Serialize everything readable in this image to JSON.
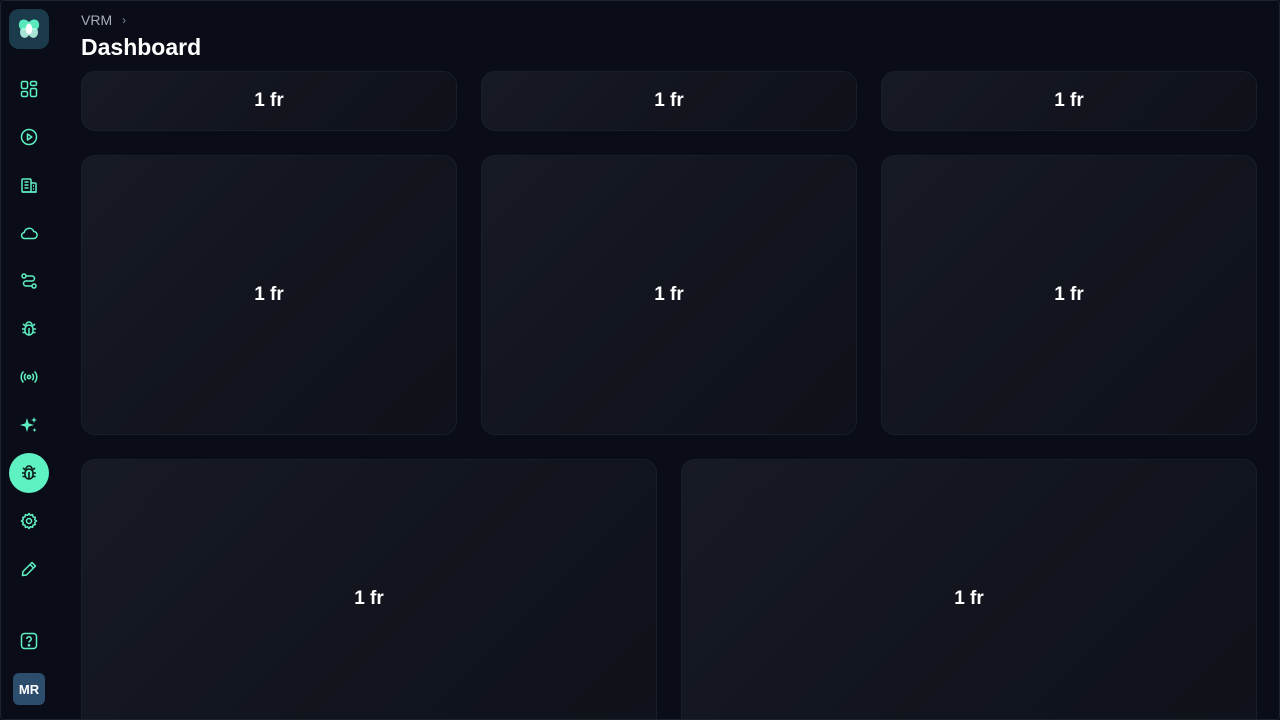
{
  "sidebar": {
    "logo": {
      "icon": "app-logo-icon",
      "color": "#5ef2c3"
    },
    "nav_items": [
      {
        "icon": "dashboard-grid-icon"
      },
      {
        "icon": "play-circle-icon"
      },
      {
        "icon": "building-icon"
      },
      {
        "icon": "cloud-icon"
      },
      {
        "icon": "route-icon"
      },
      {
        "icon": "bug-icon"
      },
      {
        "icon": "broadcast-icon"
      },
      {
        "icon": "sparkles-icon"
      },
      {
        "icon": "bug-icon",
        "active": true
      },
      {
        "icon": "gear-icon"
      },
      {
        "icon": "pencil-icon"
      }
    ],
    "help_icon": "help-icon",
    "avatar_initials": "MR",
    "accent_color": "#5ef2c3"
  },
  "header": {
    "breadcrumb": [
      "VRM"
    ],
    "title": "Dashboard"
  },
  "grid": {
    "cards": [
      {
        "label": "1 fr"
      },
      {
        "label": "1 fr"
      },
      {
        "label": "1 fr"
      },
      {
        "label": "1 fr"
      },
      {
        "label": "1 fr"
      },
      {
        "label": "1 fr"
      },
      {
        "label": "1 fr"
      },
      {
        "label": "1 fr"
      }
    ]
  }
}
